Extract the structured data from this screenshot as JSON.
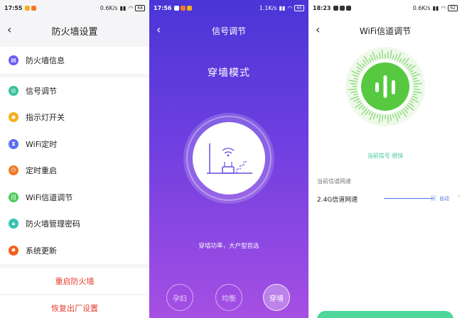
{
  "panel1": {
    "status": {
      "time": "17:55",
      "net": "0.6K/s",
      "battery": "64"
    },
    "title": "防火墙设置",
    "items": [
      {
        "label": "防火墙信息",
        "icon": "info-card-icon",
        "color": "#6a5cf0"
      },
      {
        "label": "信号调节",
        "icon": "signal-adjust-icon",
        "color": "#3ac29a"
      },
      {
        "label": "指示灯开关",
        "icon": "indicator-light-icon",
        "color": "#f2b01e"
      },
      {
        "label": "WiFi定时",
        "icon": "hourglass-icon",
        "color": "#5b6df0"
      },
      {
        "label": "定时重启",
        "icon": "power-timer-icon",
        "color": "#f07a2a"
      },
      {
        "label": "WiFi信道调节",
        "icon": "channel-bars-icon",
        "color": "#4ccc5a"
      },
      {
        "label": "防火墙管理密码",
        "icon": "lock-icon",
        "color": "#3ac2b2"
      },
      {
        "label": "系统更新",
        "icon": "update-gear-icon",
        "color": "#f2601e"
      }
    ],
    "actions": [
      "重启防火墙",
      "恢复出厂设置"
    ]
  },
  "panel2": {
    "status": {
      "time": "17:56",
      "net": "1.1K/s",
      "battery": "65"
    },
    "title": "信号调节",
    "mode_title": "穿墙模式",
    "description": "穿墙功率，大户型首选",
    "modes": [
      {
        "label": "孕妇",
        "active": false
      },
      {
        "label": "均衡",
        "active": false
      },
      {
        "label": "穿墙",
        "active": true
      }
    ]
  },
  "panel3": {
    "status": {
      "time": "18:23",
      "net": "0.6K/s",
      "battery": "62"
    },
    "title": "WiFi信道调节",
    "signal_status": "当前信号 很快",
    "section_label": "当前信道网速",
    "channel": {
      "label": "2.4G信道网速",
      "value": "自动",
      "knob": "|||"
    }
  },
  "colors": {
    "accent_red": "#e23c2c",
    "signal_green": "#56c940",
    "purple": "#6f3fe0"
  }
}
